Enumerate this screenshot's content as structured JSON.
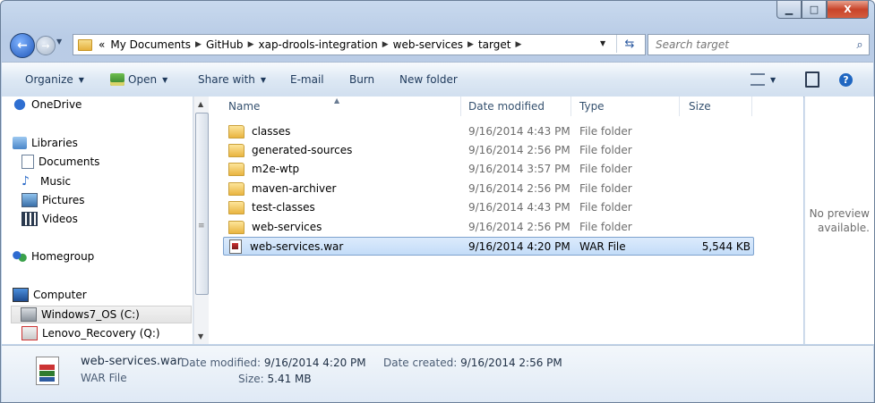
{
  "window": {
    "minimize_glyph": "▁",
    "maximize_glyph": "□",
    "close_glyph": "X"
  },
  "nav": {
    "breadcrumbs": [
      "«",
      "My Documents",
      "GitHub",
      "xap-drools-integration",
      "web-services",
      "target"
    ],
    "search_placeholder": "Search target"
  },
  "toolbar": {
    "organize": "Organize",
    "open": "Open",
    "share_with": "Share with",
    "email": "E-mail",
    "burn": "Burn",
    "new_folder": "New folder"
  },
  "sidebar": {
    "items": [
      {
        "label": "OneDrive",
        "icon": "cloud-icon"
      },
      {
        "label": "Libraries",
        "icon": "libraries-icon"
      },
      {
        "label": "Documents",
        "icon": "documents-icon"
      },
      {
        "label": "Music",
        "icon": "music-icon"
      },
      {
        "label": "Pictures",
        "icon": "pictures-icon"
      },
      {
        "label": "Videos",
        "icon": "videos-icon"
      },
      {
        "label": "Homegroup",
        "icon": "homegroup-icon"
      },
      {
        "label": "Computer",
        "icon": "computer-icon"
      },
      {
        "label": "Windows7_OS (C:)",
        "icon": "drive-icon"
      },
      {
        "label": "Lenovo_Recovery (Q:)",
        "icon": "recovery-drive-icon"
      }
    ]
  },
  "columns": {
    "name": "Name",
    "date": "Date modified",
    "type": "Type",
    "size": "Size"
  },
  "files": [
    {
      "name": "classes",
      "date": "9/16/2014 4:43 PM",
      "type": "File folder",
      "size": ""
    },
    {
      "name": "generated-sources",
      "date": "9/16/2014 2:56 PM",
      "type": "File folder",
      "size": ""
    },
    {
      "name": "m2e-wtp",
      "date": "9/16/2014 3:57 PM",
      "type": "File folder",
      "size": ""
    },
    {
      "name": "maven-archiver",
      "date": "9/16/2014 2:56 PM",
      "type": "File folder",
      "size": ""
    },
    {
      "name": "test-classes",
      "date": "9/16/2014 4:43 PM",
      "type": "File folder",
      "size": ""
    },
    {
      "name": "web-services",
      "date": "9/16/2014 2:56 PM",
      "type": "File folder",
      "size": ""
    },
    {
      "name": "web-services.war",
      "date": "9/16/2014 4:20 PM",
      "type": "WAR File",
      "size": "5,544 KB"
    }
  ],
  "preview": {
    "line1": "No preview",
    "line2": "available."
  },
  "details": {
    "filename": "web-services.war",
    "filetype": "WAR File",
    "date_modified_label": "Date modified:",
    "date_modified": "9/16/2014 4:20 PM",
    "size_label": "Size:",
    "size": "5.41 MB",
    "date_created_label": "Date created:",
    "date_created": "9/16/2014 2:56 PM"
  }
}
